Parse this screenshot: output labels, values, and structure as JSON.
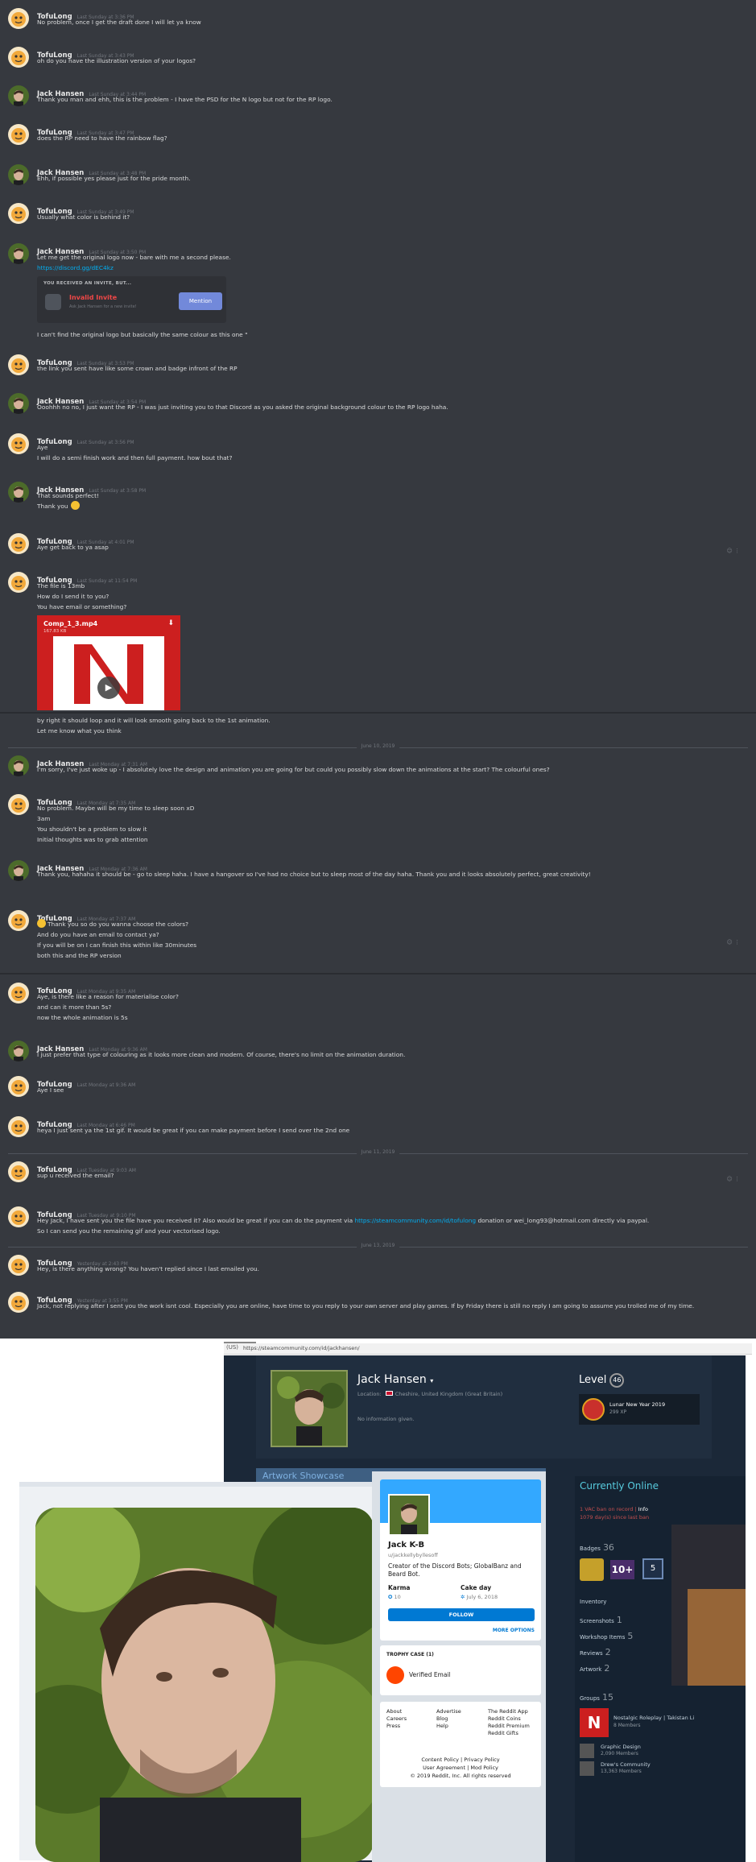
{
  "chat": {
    "messages": [
      {
        "user": "TofuLong",
        "time": "Last Sunday at 3:36 PM",
        "lines": [
          "No problem, once I get the draft done I will let ya know"
        ]
      },
      {
        "user": "TofuLong",
        "time": "Last Sunday at 3:43 PM",
        "lines": [
          "oh do you have the illustration version of your logos?"
        ]
      },
      {
        "user": "Jack Hansen",
        "time": "Last Sunday at 3:44 PM",
        "lines": [
          "Thank you man and ehh, this is the problem - I have the PSD for the N logo but not for the RP logo."
        ]
      },
      {
        "user": "TofuLong",
        "time": "Last Sunday at 3:47 PM",
        "lines": [
          "does the RP need to have the rainbow flag?"
        ]
      },
      {
        "user": "Jack Hansen",
        "time": "Last Sunday at 3:48 PM",
        "lines": [
          "Ehh, if possible yes please just for the pride month."
        ]
      },
      {
        "user": "TofuLong",
        "time": "Last Sunday at 3:49 PM",
        "lines": [
          "Usually what color is behind it?"
        ]
      },
      {
        "user": "Jack Hansen",
        "time": "Last Sunday at 3:50 PM",
        "lines": [
          "Let me get the original logo now - bare with me a second please.",
          "https://discord.gg/dEC4kz"
        ],
        "link_line": 1,
        "invite": {
          "title": "YOU RECEIVED AN INVITE, BUT...",
          "name": "Invalid Invite",
          "sub": "Ask Jack Hansen for a new invite!",
          "button": "Mention"
        },
        "after": "I can't find the original logo but basically the same colour as this one \""
      },
      {
        "user": "TofuLong",
        "time": "Last Sunday at 3:53 PM",
        "lines": [
          "the link you sent have like some crown and badge infront of the RP"
        ]
      },
      {
        "user": "Jack Hansen",
        "time": "Last Sunday at 3:54 PM",
        "lines": [
          "Ooohhh no no, I just want the RP - I was just inviting you to that Discord as you asked the original background colour to the RP logo haha."
        ]
      },
      {
        "user": "TofuLong",
        "time": "Last Sunday at 3:56 PM",
        "lines": [
          "Aye",
          "I will do a semi finish work and then full payment. how bout that?"
        ]
      },
      {
        "user": "Jack Hansen",
        "time": "Last Sunday at 3:58 PM",
        "lines": [
          "That sounds perfect!",
          "Thank you"
        ],
        "emoji_line": 1
      },
      {
        "user": "TofuLong",
        "time": "Last Sunday at 4:01 PM",
        "lines": [
          "Aye get back to ya asap"
        ]
      },
      {
        "user": "TofuLong",
        "time": "Last Sunday at 11:54 PM",
        "lines": [
          "The file is 13mb",
          "How do I send it to you?",
          "You have email or something?"
        ],
        "video": {
          "name": "Comp_1_3.mp4",
          "size": "167.83 KB"
        },
        "after_lines": [
          "by right it should loop and it will look smooth going back to the 1st animation.",
          "Let me know what you think"
        ]
      },
      {
        "user": "Jack Hansen",
        "time": "Last Monday at 7:31 AM",
        "lines": [
          "I'm sorry, I've just woke up - I absolutely love the design and animation you are going for but could you possibly slow down the animations at the start? The colourful ones?"
        ]
      },
      {
        "user": "TofuLong",
        "time": "Last Monday at 7:35 AM",
        "lines": [
          "No problem. Maybe will be my time to sleep soon xD",
          "3am",
          "You shouldn't be a problem to slow it",
          "Initial thoughts was to grab attention"
        ]
      },
      {
        "user": "Jack Hansen",
        "time": "Last Monday at 7:36 AM",
        "lines": [
          "Thank you, hahaha it should be - go to sleep haha. I have a hangover so I've had no choice but to sleep most of the day haha. Thank you and it looks absolutely perfect, great creativity!"
        ]
      },
      {
        "user": "TofuLong",
        "time": "Last Monday at 7:37 AM",
        "lines": [
          "Thank you  so do you wanna choose the colors?",
          "And do you have an email to contact ya?",
          "If you will be on I can finish this within like 30minutes",
          "both this and the RP version"
        ],
        "emoji_line": 0
      },
      {
        "user": "TofuLong",
        "time": "Last Monday at 9:35 AM",
        "lines": [
          "Aye, is there like a reason for materialise color?",
          "and can it more than 5s?",
          "now the whole animation is 5s"
        ]
      },
      {
        "user": "Jack Hansen",
        "time": "Last Monday at 9:36 AM",
        "lines": [
          "I just prefer that type of colouring as it looks more clean and modern. Of course, there's no limit on the animation duration."
        ]
      },
      {
        "user": "TofuLong",
        "time": "Last Monday at 9:36 AM",
        "lines": [
          "Aye I see"
        ]
      },
      {
        "user": "TofuLong",
        "time": "Last Monday at 6:46 PM",
        "lines": [
          "heya I just sent ya the 1st gif. It would be great if you can make payment before I send over the 2nd one"
        ]
      },
      {
        "user": "TofuLong",
        "time": "Last Tuesday at 9:03 AM",
        "lines": [
          "sup u received the email?"
        ]
      },
      {
        "user": "TofuLong",
        "time": "Last Tuesday at 9:10 PM",
        "lines": [
          "Hey Jack, I have sent you the file have you received it? Also would be great if you can do the payment via https://steamcommunity.com/id/tofulong donation or wei_long93@hotmail.com directly via paypal.",
          "So I can send you the remaining gif and your vectorised logo."
        ]
      },
      {
        "user": "TofuLong",
        "time": "Yesterday at 2:43 PM",
        "lines": [
          "Hey, is there anything wrong? You haven't replied since I last emailed you."
        ]
      },
      {
        "user": "TofuLong",
        "time": "Yesterday at 3:55 PM",
        "lines": [
          "Jack, not replying after I sent you the work isnt cool.  Especially you are online, have time to you reply to your own server and play games. If by Friday there is still no reply I am going to assume you trolled me of my time."
        ]
      }
    ],
    "dividers": [
      "June 10, 2019",
      "June 11, 2019",
      "June 13, 2019"
    ]
  },
  "browser": {
    "lock": "(US)",
    "url": "https://steamcommunity.com/id/jackhansen/"
  },
  "steam": {
    "name": "Jack Hansen",
    "location_label": "Location:",
    "location": "Cheshire, United Kingdom (Great Britain)",
    "no_info": "No information given.",
    "level_label": "Level",
    "level": "46",
    "badge_name": "Lunar New Year 2019",
    "badge_xp": "299 XP",
    "artwork_title": "Artwork Showcase",
    "online": "Currently Online",
    "vac": "1 VAC ban on record",
    "vac_info": "Info",
    "vac_days": "1079 day(s) since last ban",
    "badges_label": "Badges",
    "badges_count": "36",
    "badge2": "10+",
    "badge3": "5",
    "inventory": "Inventory",
    "screenshots": "Screenshots",
    "screenshots_count": "1",
    "workshop": "Workshop Items",
    "workshop_count": "5",
    "reviews": "Reviews",
    "reviews_count": "2",
    "artwork": "Artwork",
    "artwork_count": "2",
    "groups_label": "Groups",
    "groups_count": "15",
    "groups": [
      {
        "name": "Nostalgic Roleplay | Takistan Li",
        "sub": "8 Members"
      },
      {
        "name": "Graphic Design",
        "sub": "2,090 Members"
      },
      {
        "name": "Drew's Community",
        "sub": "13,363 Members"
      }
    ]
  },
  "reddit": {
    "name": "Jack K-B",
    "username": "u/jackkellybyllesoff",
    "description": "Creator of the Discord Bots; GlobalBanz and Beard Bot.",
    "karma_label": "Karma",
    "karma": "10",
    "cake_label": "Cake day",
    "cake": "July 6, 2018",
    "follow": "FOLLOW",
    "more_options": "MORE OPTIONS",
    "trophy_title": "TROPHY CASE (1)",
    "trophy": "Verified Email",
    "footer_col1": [
      "About",
      "Careers",
      "Press"
    ],
    "footer_col2": [
      "Advertise",
      "Blog",
      "Help"
    ],
    "footer_col3": [
      "The Reddit App",
      "Reddit Coins",
      "Reddit Premium",
      "Reddit Gifts"
    ],
    "footer_line1": "Content Policy |  Privacy Policy",
    "footer_line2": "User Agreement |  Mod Policy",
    "footer_line3": "© 2019 Reddit, Inc. All rights reserved"
  }
}
